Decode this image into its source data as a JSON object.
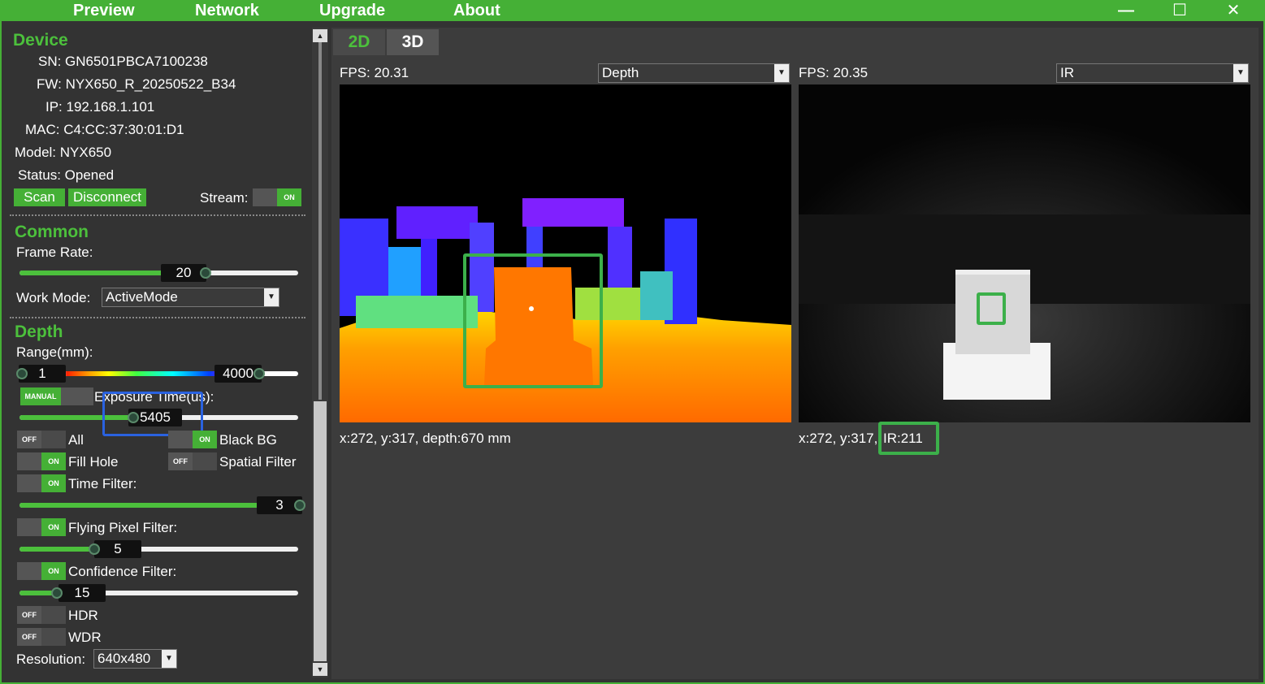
{
  "nav": [
    "Preview",
    "Network",
    "Upgrade",
    "About"
  ],
  "window": {
    "minimize": "—",
    "maximize": "☐",
    "close": "✕"
  },
  "device": {
    "title": "Device",
    "sn": "SN: GN6501PBCA7100238",
    "fw": "FW: NYX650_R_20250522_B34",
    "ip": "IP: 192.168.1.101",
    "mac": "MAC: C4:CC:37:30:01:D1",
    "model": "Model: NYX650",
    "status": "Status: Opened",
    "scan": "Scan",
    "disconnect": "Disconnect",
    "stream_label": "Stream:",
    "stream_state": "ON"
  },
  "common": {
    "title": "Common",
    "frame_rate_label": "Frame Rate:",
    "frame_rate_value": "20",
    "work_mode_label": "Work Mode:",
    "work_mode_value": "ActiveMode"
  },
  "depth": {
    "title": "Depth",
    "range_label": "Range(mm):",
    "range_min": "1",
    "range_max": "4000",
    "exposure_mode": "MANUAL",
    "exposure_label": "Exposure Time(us):",
    "exposure_value": "5405",
    "all_state": "OFF",
    "all_label": "All",
    "blackbg_state": "ON",
    "blackbg_label": "Black BG",
    "fillhole_state": "ON",
    "fillhole_label": "Fill Hole",
    "spatial_state": "OFF",
    "spatial_label": "Spatial Filter",
    "time_state": "ON",
    "time_label": "Time Filter:",
    "time_value": "3",
    "flying_state": "ON",
    "flying_label": "Flying Pixel Filter:",
    "flying_value": "5",
    "conf_state": "ON",
    "conf_label": "Confidence Filter:",
    "conf_value": "15",
    "hdr_state": "OFF",
    "hdr_label": "HDR",
    "wdr_state": "OFF",
    "wdr_label": "WDR",
    "resolution_label": "Resolution:",
    "resolution_value": "640x480"
  },
  "tabs": [
    "2D",
    "3D"
  ],
  "left_view": {
    "fps": "FPS: 20.31",
    "mode": "Depth",
    "readout": "x:272, y:317, depth:670 mm"
  },
  "right_view": {
    "fps": "FPS: 20.35",
    "mode": "IR",
    "readout_prefix": "x:272, y:317,",
    "readout_ir": "IR:211"
  },
  "colors": {
    "accent": "#45b036",
    "highlight_blue": "#2a62e0",
    "panel_bg": "#333333"
  }
}
